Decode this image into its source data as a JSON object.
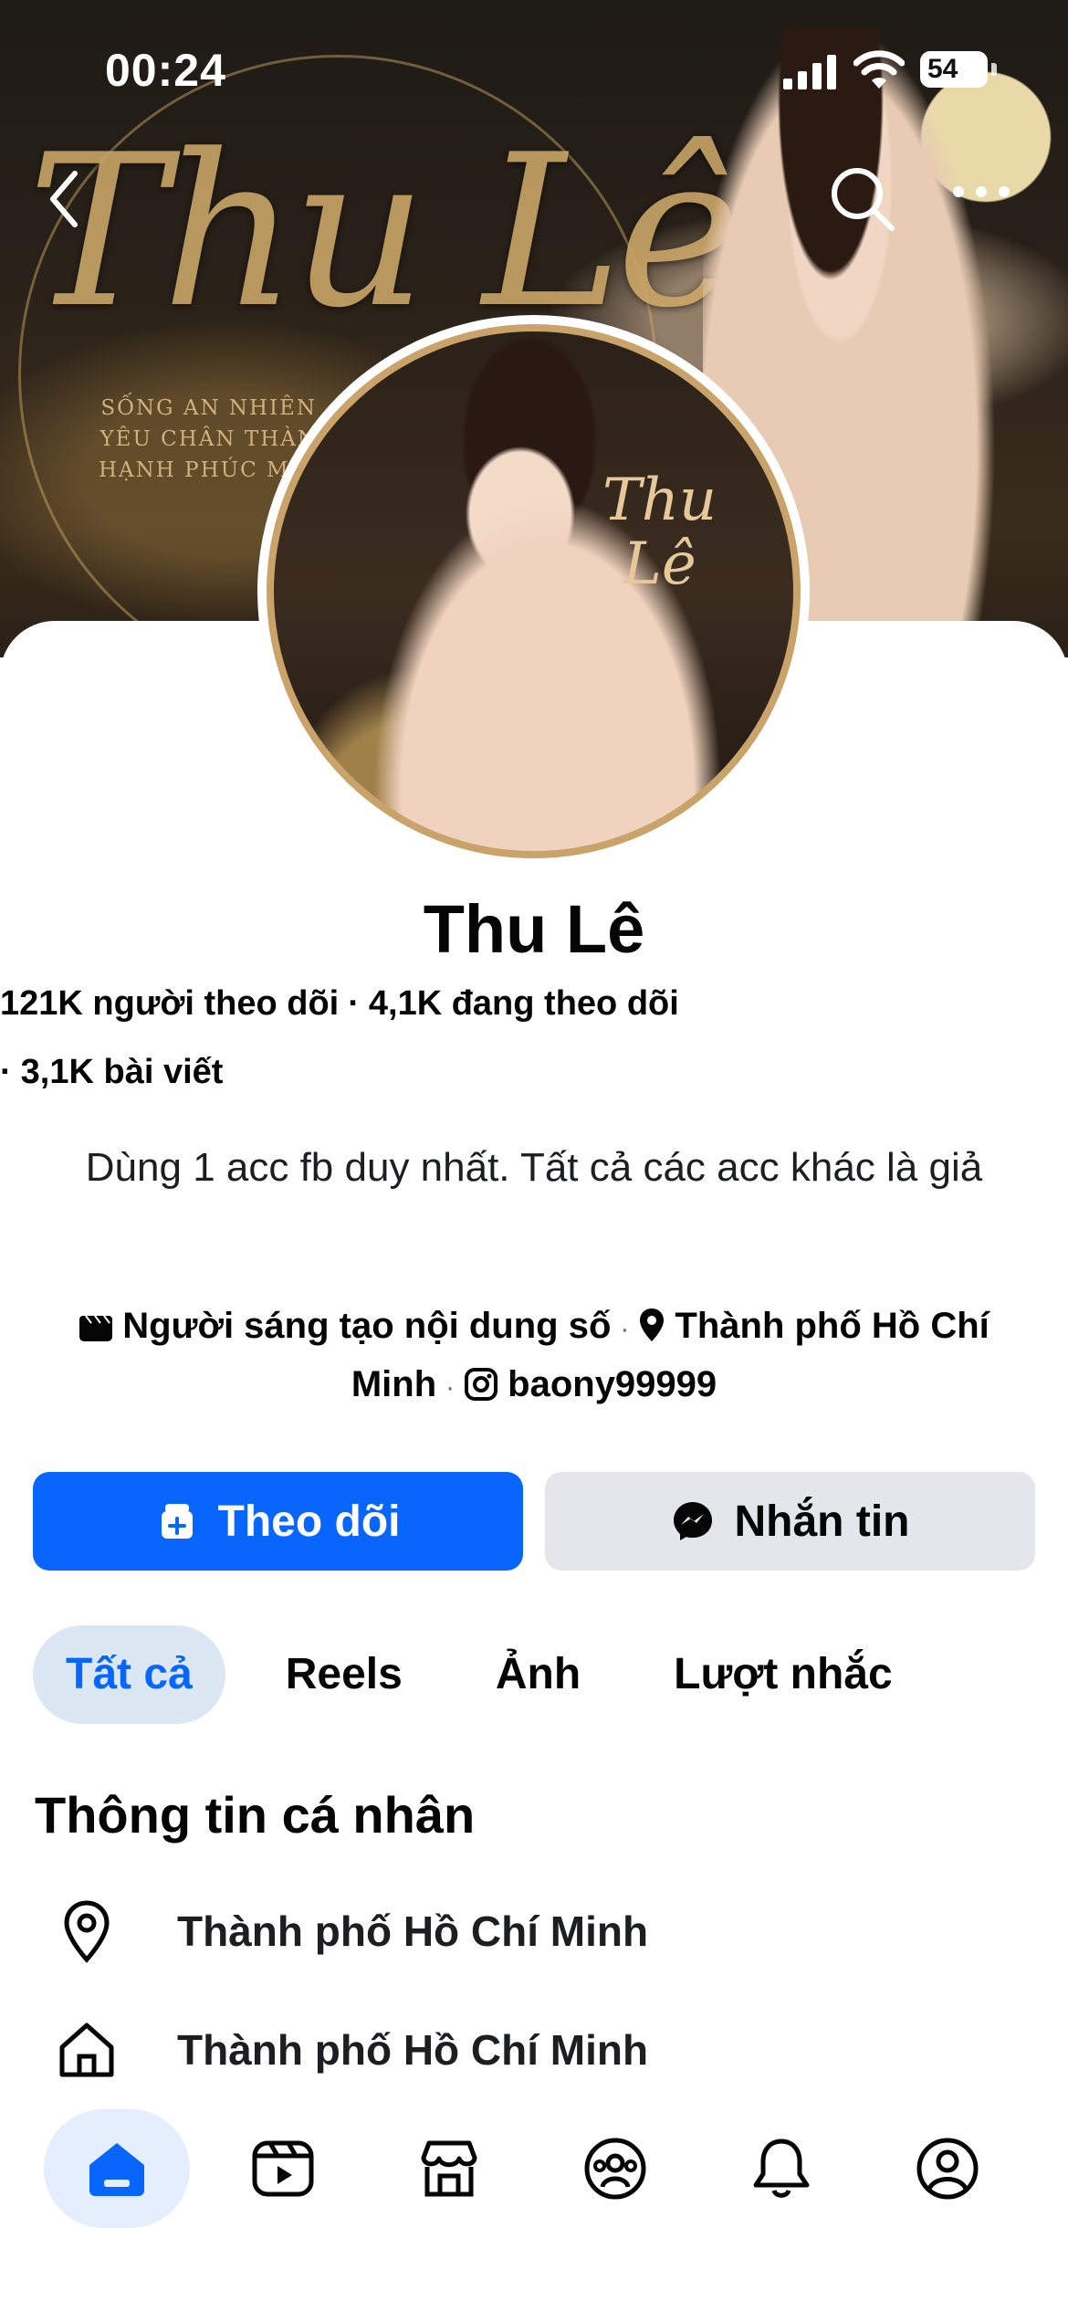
{
  "status_bar": {
    "time": "00:24",
    "battery": "54"
  },
  "cover": {
    "script_title": "Thu Lê",
    "poem_lines": [
      "SỐNG AN NHIÊN",
      "YÊU CHÂN THÀN",
      "HẠNH PHÚC MỖI"
    ]
  },
  "avatar": {
    "signature": "Thu\nLê"
  },
  "profile": {
    "name": "Thu Lê",
    "followers": "121K người theo dõi",
    "following": "4,1K đang theo dõi",
    "posts": "3,1K bài viết",
    "bio": "Dùng 1 acc fb duy nhất. Tất cả các acc khác là giả",
    "category": "Người sáng tạo nội dung số",
    "location": "Thành phố Hồ Chí Minh",
    "instagram": "baony99999"
  },
  "actions": {
    "follow": "Theo dõi",
    "message": "Nhắn tin"
  },
  "tabs": [
    {
      "label": "Tất cả",
      "active": true
    },
    {
      "label": "Reels",
      "active": false
    },
    {
      "label": "Ảnh",
      "active": false
    },
    {
      "label": "Lượt nhắc",
      "active": false
    }
  ],
  "intro": {
    "title": "Thông tin cá nhân",
    "items": [
      {
        "icon": "location-pin-icon",
        "text": "Thành phố Hồ Chí Minh"
      },
      {
        "icon": "home-icon",
        "text": "Thành phố Hồ Chí Minh"
      }
    ]
  },
  "bottom_nav": [
    {
      "icon": "home-icon",
      "active": true
    },
    {
      "icon": "video-icon",
      "active": false
    },
    {
      "icon": "marketplace-icon",
      "active": false
    },
    {
      "icon": "groups-icon",
      "active": false
    },
    {
      "icon": "bell-icon",
      "active": false
    },
    {
      "icon": "profile-icon",
      "active": false
    }
  ],
  "colors": {
    "accent": "#0866ff",
    "secondary_button": "#e4e6eb",
    "active_tab_bg": "#dbe7f2"
  }
}
